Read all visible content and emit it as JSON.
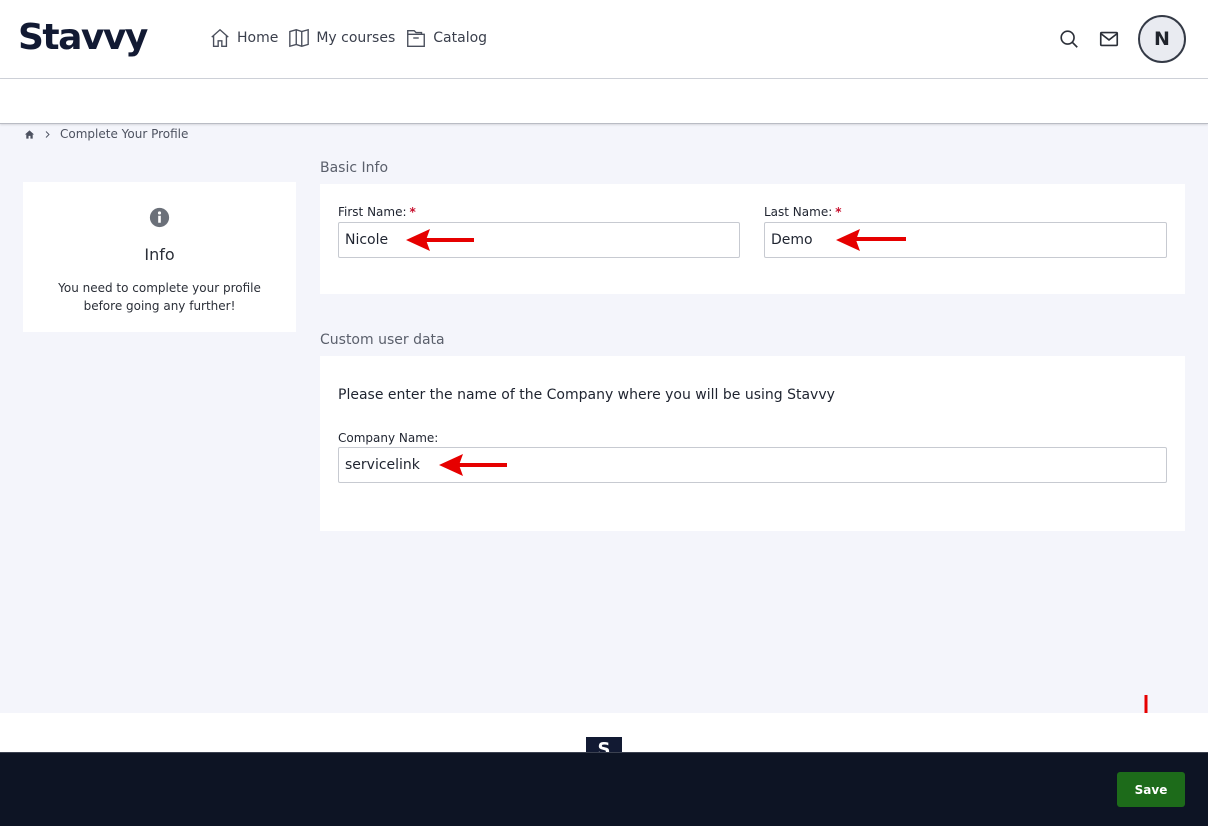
{
  "brand": {
    "logo": "Stavvy"
  },
  "nav": [
    {
      "label": "Home",
      "icon": "home-icon"
    },
    {
      "label": "My courses",
      "icon": "book-icon"
    },
    {
      "label": "Catalog",
      "icon": "catalog-icon"
    }
  ],
  "header": {
    "avatar_initial": "N"
  },
  "breadcrumb": {
    "current": "Complete Your Profile"
  },
  "info": {
    "title": "Info",
    "message": "You need to complete your profile before going any further!"
  },
  "basic_info": {
    "title": "Basic Info",
    "first_name_label": "First Name:",
    "first_name_value": "Nicole",
    "last_name_label": "Last Name:",
    "last_name_value": "Demo",
    "required_mark": "*"
  },
  "custom_data": {
    "title": "Custom user data",
    "description": "Please enter the name of the Company where you will be using Stavvy",
    "company_label": "Company Name:",
    "company_value": "servicelink"
  },
  "footer": {
    "logo_letter": "S",
    "save_label": "Save"
  },
  "colors": {
    "annotation_arrow": "#e60000",
    "save_button": "#1d6b1a",
    "bottom_bar": "#0d1424"
  }
}
